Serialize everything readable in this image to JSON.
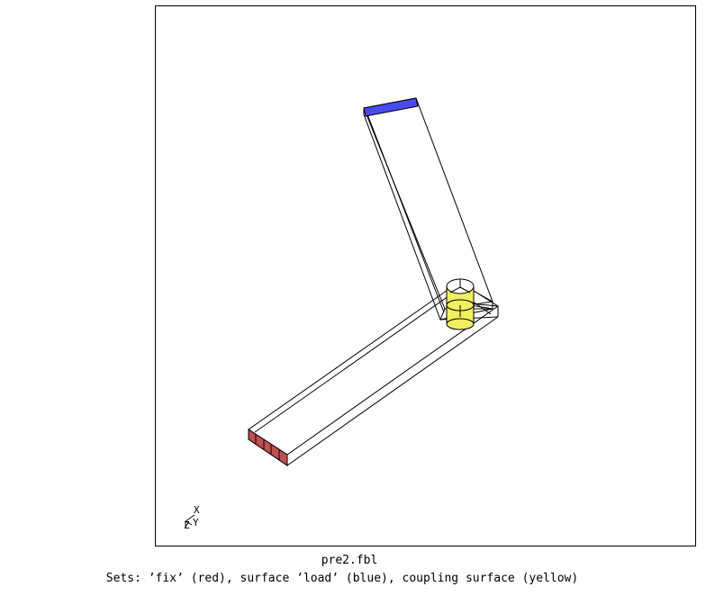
{
  "viewport": {
    "colors": {
      "frame": "#000000",
      "wire": "#000000",
      "fix_set": "#c05050",
      "load_surface": "#4a4af0",
      "coupling_surface": "#f0f060"
    }
  },
  "axis_triad": {
    "x_label": "X",
    "y_label": "Y",
    "z_label": "Z"
  },
  "footer": {
    "file_name": "pre2.fbl",
    "caption": "Sets: ’fix’ (red), surface ’load’ (blue), coupling surface (yellow)"
  }
}
